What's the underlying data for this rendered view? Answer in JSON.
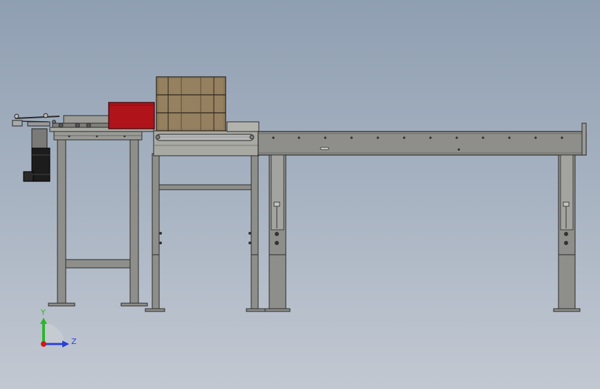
{
  "view": {
    "background_top": "#8f9fb2",
    "background_bottom": "#c2c8d2"
  },
  "colors": {
    "steel": "#8e8e8a",
    "steel_dark": "#6e6e6a",
    "steel_light": "#a9a9a4",
    "outline": "#2a2a2a",
    "red_box": "#b0131a",
    "cardboard": "#8e7a5a",
    "motor": "#1c1c1c",
    "roller": "#b6b8b8",
    "axis_y": "#2db52d",
    "axis_z": "#2a3fd6",
    "axis_origin": "#d01818"
  },
  "triad": {
    "y_label": "Y",
    "z_label": "Z"
  },
  "icons": {
    "view_orientation": "axis-triad-icon"
  }
}
